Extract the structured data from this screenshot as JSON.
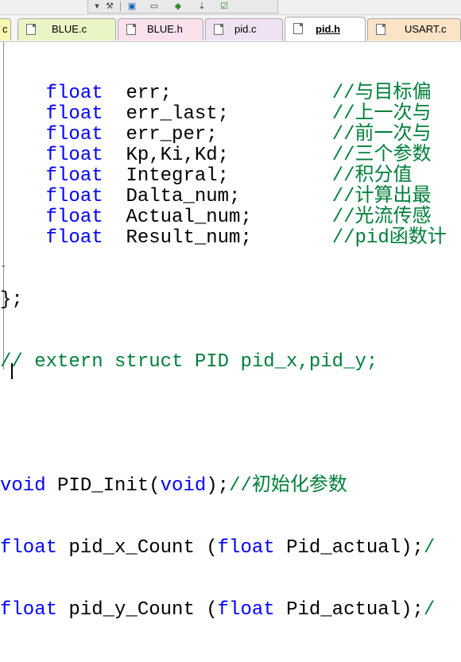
{
  "toolbar": {
    "icons": [
      "dropdown-arrow-icon",
      "tool-icon",
      "window-icon",
      "layout-icon",
      "diamond-icon",
      "arrow-down-icon",
      "check-image-icon"
    ]
  },
  "tabs": [
    {
      "label": "c",
      "color": "#f7f7b2",
      "partial": true
    },
    {
      "label": "BLUE.c",
      "color": "#e9f5c4"
    },
    {
      "label": "BLUE.h",
      "color": "#fbe0ee"
    },
    {
      "label": "pid.c",
      "color": "#efe3f3"
    },
    {
      "label": "pid.h",
      "color": "#ffffff",
      "active": true
    },
    {
      "label": "USART.c",
      "color": "#fbe3c6"
    }
  ],
  "code_lines": [
    {
      "indent": "    ",
      "type": "float",
      "name": "err;",
      "pad": "              ",
      "comment": "//与目标偏"
    },
    {
      "indent": "    ",
      "type": "float",
      "name": "err_last;",
      "pad": "         ",
      "comment": "//上一次与"
    },
    {
      "indent": "    ",
      "type": "float",
      "name": "err_per;",
      "pad": "          ",
      "comment": "//前一次与"
    },
    {
      "indent": "    ",
      "type": "float",
      "name": "Kp,Ki,Kd;",
      "pad": "         ",
      "comment": "//三个参数"
    },
    {
      "indent": "    ",
      "type": "float",
      "name": "Integral;",
      "pad": "         ",
      "comment": "//积分值"
    },
    {
      "indent": "    ",
      "type": "float",
      "name": "Dalta_num;",
      "pad": "        ",
      "comment": "//计算出最"
    },
    {
      "indent": "    ",
      "type": "float",
      "name": "Actual_num;",
      "pad": "       ",
      "comment": "//光流传感"
    },
    {
      "indent": "    ",
      "type": "float",
      "name": "Result_num;",
      "pad": "       ",
      "comment": "//pid函数计"
    }
  ],
  "closing_line": "};",
  "extern_comment": "// extern struct PID pid_x,pid_y;",
  "init_line": {
    "type": "void",
    "name": " PID_Init(",
    "param_type": "void",
    "close": ");",
    "comment": "//初始化参数"
  },
  "count_lines": [
    {
      "type": "float",
      "name": " pid_x_Count (",
      "param_type": "float",
      "param": " Pid_actual);",
      "comment": "/"
    },
    {
      "type": "float",
      "name": " pid_y_Count (",
      "param_type": "float",
      "param": " Pid_actual);",
      "comment": "/"
    }
  ]
}
